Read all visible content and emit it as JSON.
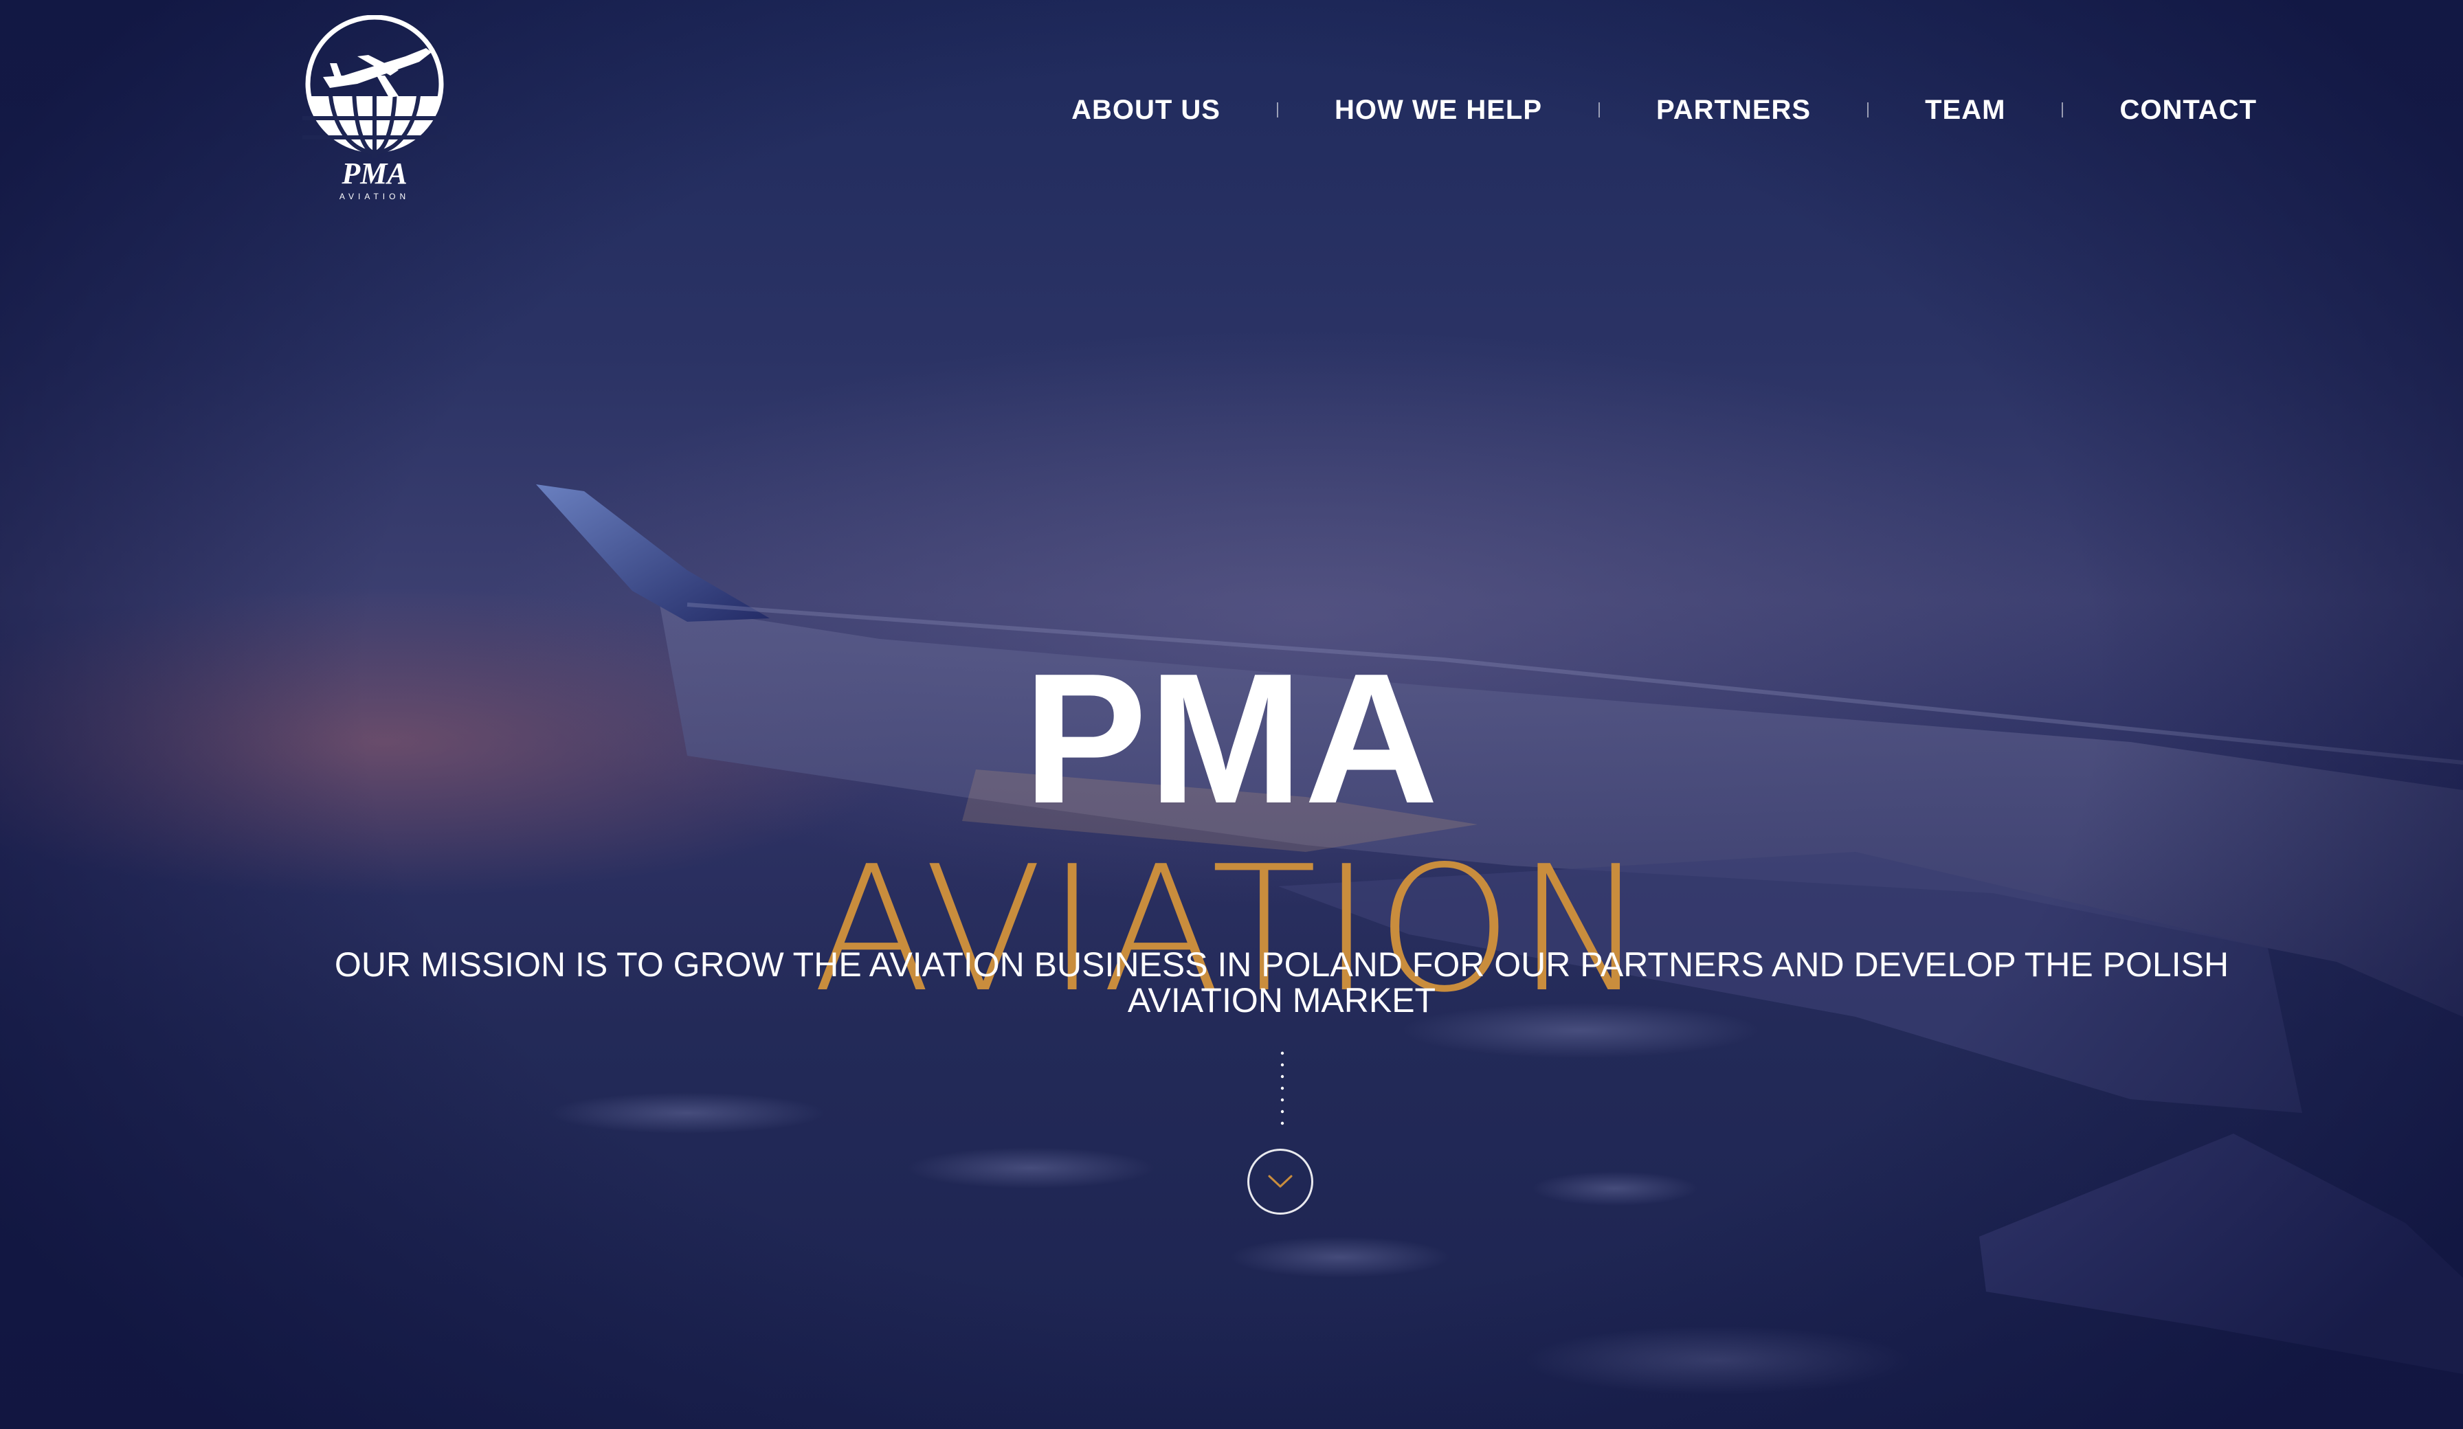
{
  "brand": {
    "logo_text": "PMA",
    "logo_subtext": "AVIATION"
  },
  "nav": {
    "items": [
      {
        "label": "ABOUT US"
      },
      {
        "label": "HOW WE HELP"
      },
      {
        "label": "PARTNERS"
      },
      {
        "label": "TEAM"
      },
      {
        "label": "CONTACT"
      }
    ]
  },
  "hero": {
    "title": "PMA",
    "subtitle": "AVIATION",
    "mission": "OUR MISSION IS TO GROW THE AVIATION BUSINESS IN POLAND FOR OUR PARTNERS AND DEVELOP THE POLISH AVIATION MARKET"
  },
  "icons": {
    "logo": "plane-globe-icon",
    "scroll": "chevron-down-icon"
  },
  "colors": {
    "background": "#1d2553",
    "accent": "#c98d3d",
    "text": "#ffffff"
  }
}
